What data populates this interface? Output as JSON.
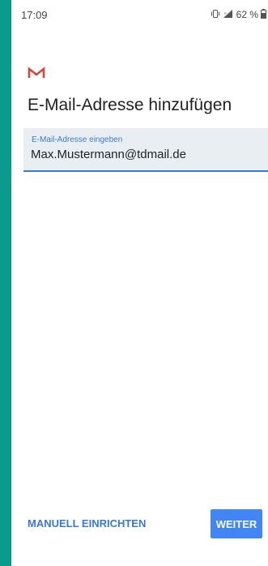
{
  "status_bar": {
    "time": "17:09",
    "battery_percent": "62 %",
    "icons": [
      "vibrate-icon",
      "signal-icon",
      "battery-icon"
    ]
  },
  "app": {
    "logo": "gmail-logo-icon",
    "title": "E-Mail-Adresse hinzufügen"
  },
  "email_field": {
    "label": "E-Mail-Adresse eingeben",
    "value": "Max.Mustermann@tdmail.de"
  },
  "actions": {
    "manual_setup_label": "MANUELL EINRICHTEN",
    "next_label": "WEITER"
  },
  "colors": {
    "background_accent": "#0a9b8d",
    "primary": "#4285f4",
    "link": "#3478e0",
    "gmail_red": "#db4437"
  }
}
